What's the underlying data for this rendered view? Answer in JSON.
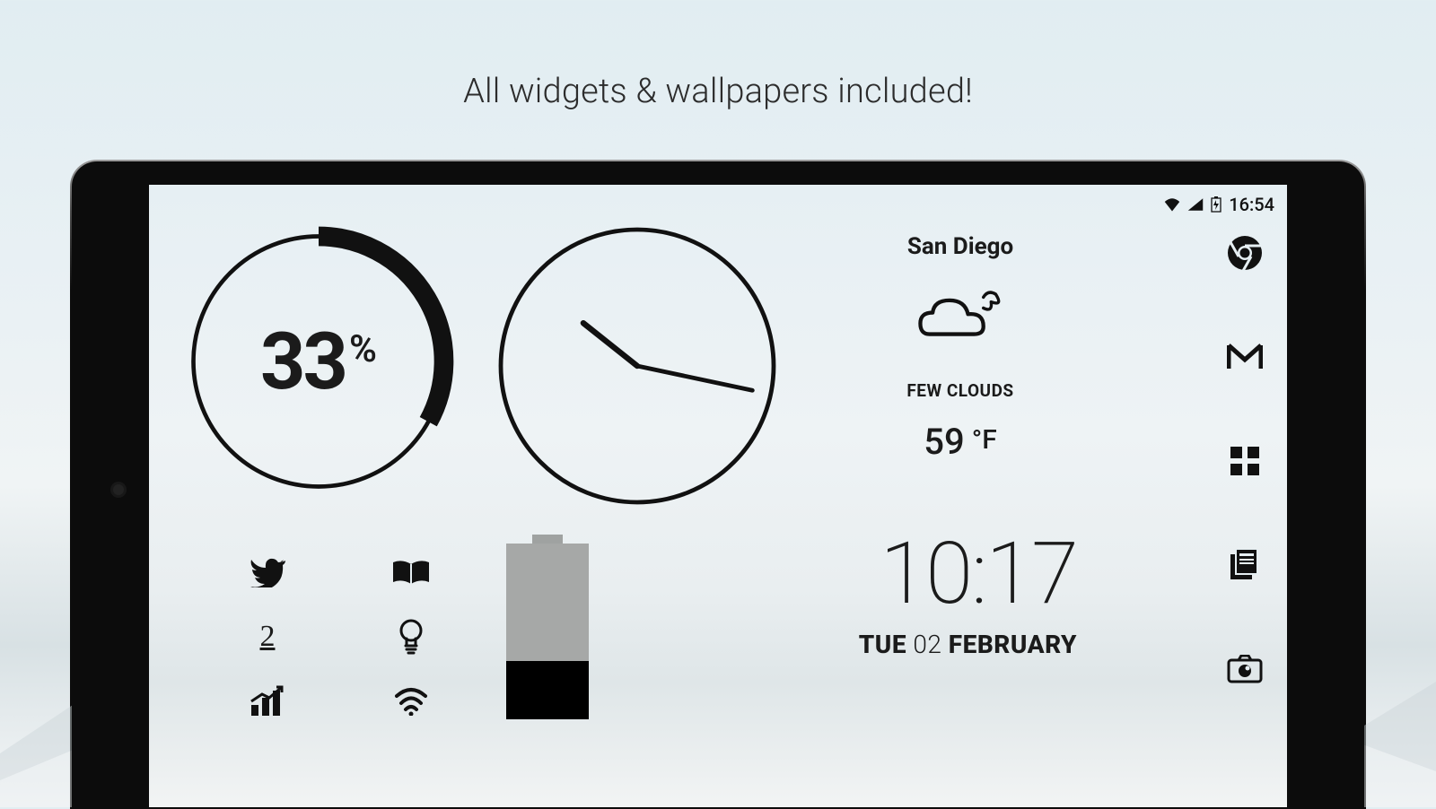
{
  "headline": "All widgets & wallpapers included!",
  "statusbar": {
    "time": "16:54"
  },
  "battery_ring": {
    "percent": 33,
    "percent_label": "33",
    "percent_unit": "%"
  },
  "analog_clock": {
    "hour": 10,
    "minute": 17
  },
  "weather": {
    "city": "San Diego",
    "description": "FEW CLOUDS",
    "temp_value": "59",
    "temp_unit": "°F"
  },
  "digital": {
    "time": "10:17",
    "day_abbrev": "TUE",
    "day_num": "02",
    "month": "FEBRUARY"
  },
  "battery_widget": {
    "fill_percent": 33
  },
  "app_icons": {
    "right_col": [
      "chrome",
      "gmail",
      "app-drawer",
      "news",
      "camera"
    ],
    "left_grid": [
      "twitter",
      "book",
      "number-two",
      "lightbulb",
      "chart",
      "wifi"
    ]
  }
}
